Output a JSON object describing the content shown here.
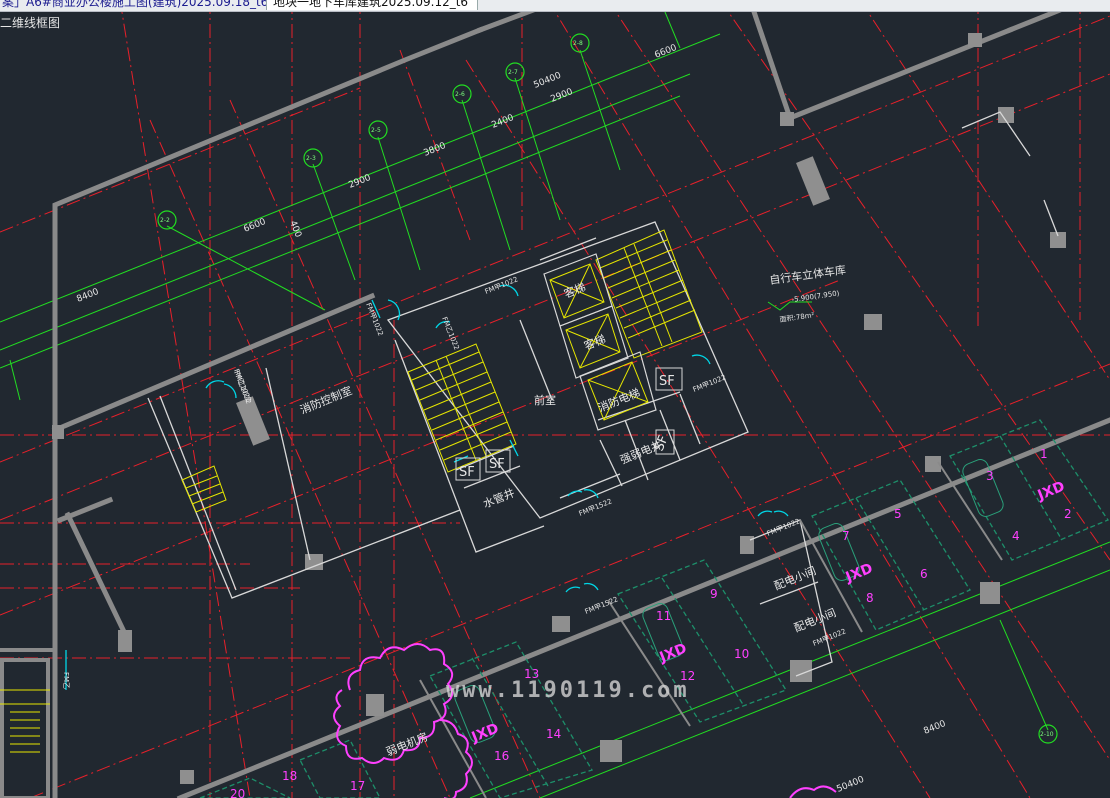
{
  "tabs": [
    {
      "label": "案」A6#商业办公楼施工图(建筑)2025.09.18_t6",
      "active": false
    },
    {
      "label": "地块一地下车库建筑2025.09.12_t6",
      "active": true
    }
  ],
  "view_label": "二维线框图",
  "watermark": "www.1190119.com",
  "rooms": {
    "fire_control": "消防控制室",
    "antechamber": "前室",
    "elevator_1": "客梯",
    "elevator_2": "客梯",
    "fire_elevator": "消防电梯",
    "water_shaft": "水管井",
    "strong_weak_shaft": "强弱电井",
    "bike_garage": "自行车立体车库",
    "elevation": "-5.900(7.950)",
    "area_note": "面积:78m²",
    "distribution_1": "配电小间",
    "distribution_2": "配电小间",
    "weak_room": "弱电机房"
  },
  "doors": {
    "d1": "FM甲1022",
    "d2": "FM乙1022",
    "d3": "FM乙1022",
    "d4": "FM甲1522",
    "d5": "FM甲1022",
    "d6": "FM甲1022",
    "d7": "FM甲1022",
    "d8": "FM甲1022",
    "d9": "FM甲1522",
    "d10": "FM乙1022",
    "d11": "FM乙"
  },
  "dims": {
    "d8400a": "8400",
    "d6600a": "6600",
    "d2900a": "2900",
    "d3800": "3800",
    "d2400": "2400",
    "d2900b": "2900",
    "d50400a": "50400",
    "d6600b": "6600",
    "d8400b": "8400",
    "d50400b": "50400",
    "side": "400"
  },
  "axes": [
    "2-2",
    "2-3",
    "2-5",
    "2-6",
    "2-7",
    "2-8",
    "2-10"
  ],
  "sf_labels": [
    "SF",
    "SF",
    "SF",
    "SF"
  ],
  "parking": {
    "numbers": [
      "1",
      "2",
      "3",
      "4",
      "5",
      "6",
      "7",
      "8",
      "9",
      "10",
      "11",
      "12",
      "13",
      "14",
      "16",
      "17",
      "18",
      "20"
    ],
    "jxd": [
      "JXD",
      "JXD",
      "JXD",
      "JXD"
    ]
  },
  "colors": {
    "background": "#212830",
    "grid_red": "#e8202a",
    "axis_green": "#22dd22",
    "wall_gray": "#8a8a8a",
    "stair_yellow": "#e6e600",
    "door_cyan": "#00d6e6",
    "parking_magenta": "#ff40ff",
    "parking_green": "#1d8f6a",
    "partition_white": "#d8d8d8"
  }
}
